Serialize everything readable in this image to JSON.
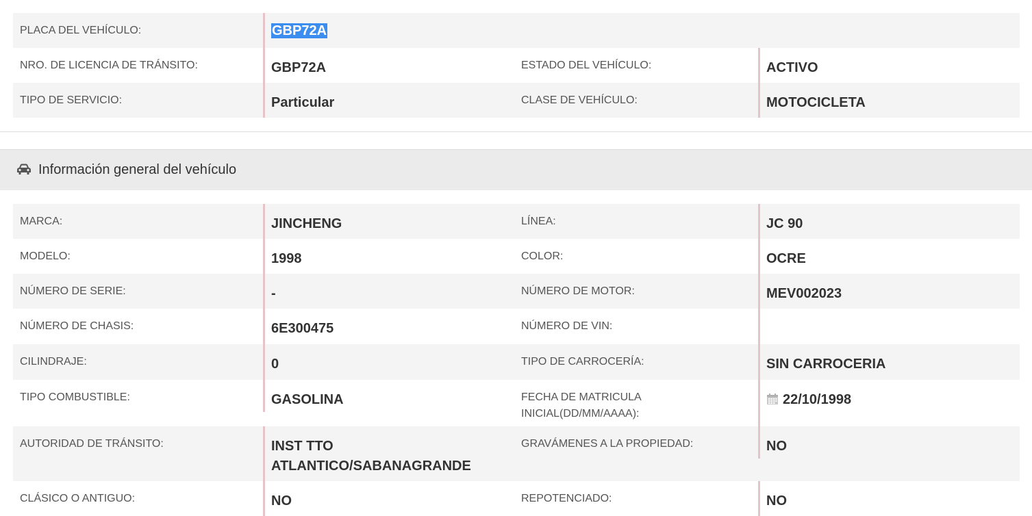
{
  "top": {
    "rows": [
      {
        "label1": "PLACA DEL VEHÍCULO:",
        "value1": "GBP72A"
      },
      {
        "label1": "NRO. DE LICENCIA DE TRÁNSITO:",
        "value1": "GBP72A",
        "label2": "ESTADO DEL VEHÍCULO:",
        "value2": "ACTIVO"
      },
      {
        "label1": "TIPO DE SERVICIO:",
        "value1": "Particular",
        "label2": "CLASE DE VEHÍCULO:",
        "value2": "MOTOCICLETA"
      }
    ]
  },
  "section": {
    "title": "Información general del vehículo",
    "icon": "car-icon"
  },
  "general": {
    "rows": [
      {
        "label1": "MARCA:",
        "value1": "JINCHENG",
        "label2": "LÍNEA:",
        "value2": "JC 90"
      },
      {
        "label1": "MODELO:",
        "value1": "1998",
        "label2": "COLOR:",
        "value2": "OCRE"
      },
      {
        "label1": "NÚMERO DE SERIE:",
        "value1": "-",
        "label2": "NÚMERO DE MOTOR:",
        "value2": "MEV002023"
      },
      {
        "label1": "NÚMERO DE CHASIS:",
        "value1": "6E300475",
        "label2": "NÚMERO DE VIN:",
        "value2": ""
      },
      {
        "label1": "CILINDRAJE:",
        "value1": "0",
        "label2": "TIPO DE CARROCERÍA:",
        "value2": "SIN CARROCERIA"
      },
      {
        "label1": "TIPO COMBUSTIBLE:",
        "value1": "GASOLINA",
        "label2a": "FECHA DE MATRICULA",
        "label2b": "INICIAL(DD/MM/AAAA):",
        "value2": "22/10/1998",
        "value2_icon": "calendar-icon"
      },
      {
        "label1": "AUTORIDAD DE TRÁNSITO:",
        "value1a": "INST TTO",
        "value1b": "ATLANTICO/SABANAGRANDE",
        "label2": "GRAVÁMENES A LA PROPIEDAD:",
        "value2": "NO"
      },
      {
        "label1": "CLÁSICO O ANTIGUO:",
        "value1": "NO",
        "label2": "REPOTENCIADO:",
        "value2": "NO"
      }
    ]
  },
  "colors": {
    "row_shade": "#f4f4f4",
    "value_bar": "#e6c3c8",
    "selection": "#3b8df0",
    "section_bg": "#ebebeb"
  }
}
